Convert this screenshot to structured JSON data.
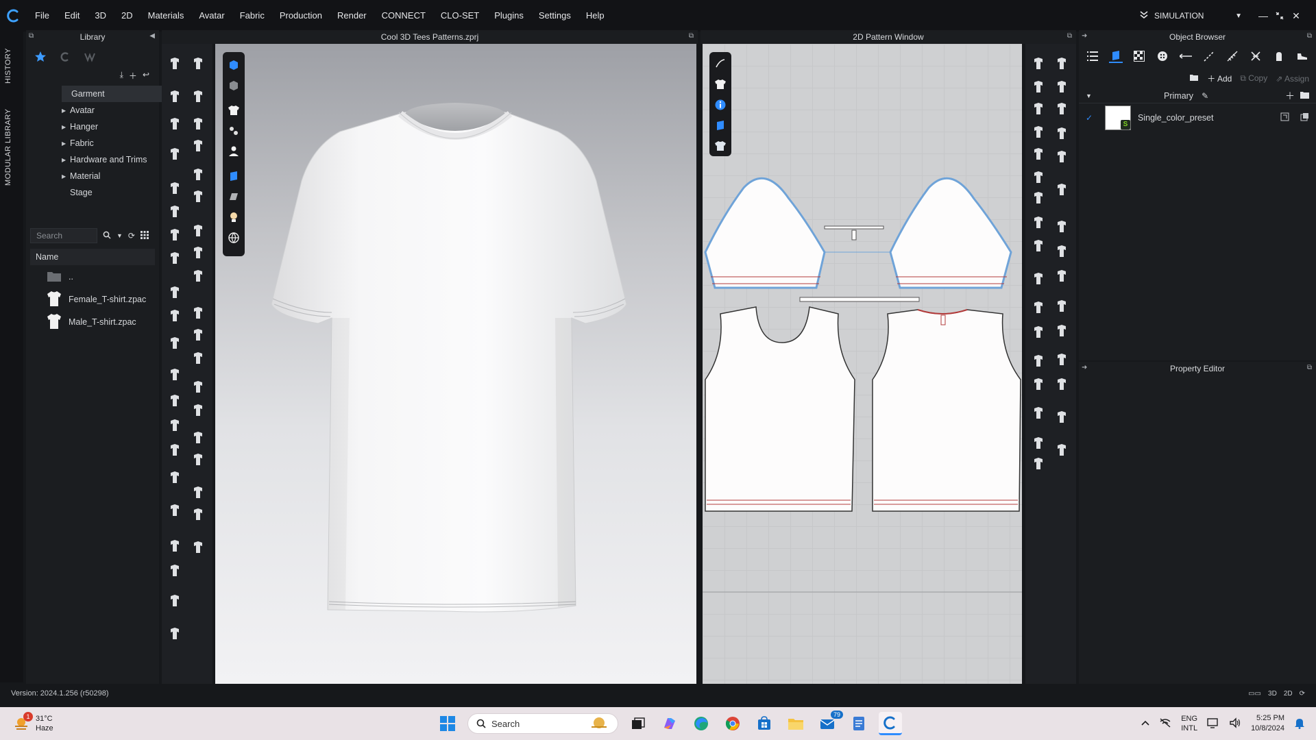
{
  "app": {
    "menu": [
      "File",
      "Edit",
      "3D",
      "2D",
      "Materials",
      "Avatar",
      "Fabric",
      "Production",
      "Render",
      "CONNECT",
      "CLO-SET",
      "Plugins",
      "Settings",
      "Help"
    ],
    "mode_label": "SIMULATION",
    "version": "Version: 2024.1.256 (r50298)"
  },
  "side_tabs": [
    "HISTORY",
    "MODULAR LIBRARY"
  ],
  "library": {
    "title": "Library",
    "tree": [
      {
        "label": "Garment",
        "expandable": false,
        "selected": true
      },
      {
        "label": "Avatar",
        "expandable": true
      },
      {
        "label": "Hanger",
        "expandable": true
      },
      {
        "label": "Fabric",
        "expandable": true
      },
      {
        "label": "Hardware and Trims",
        "expandable": true
      },
      {
        "label": "Material",
        "expandable": true
      },
      {
        "label": "Stage",
        "expandable": false
      }
    ],
    "search_placeholder": "Search",
    "column_header": "Name",
    "files": [
      {
        "label": "..",
        "icon": "folder-icon"
      },
      {
        "label": "Female_T-shirt.zpac",
        "icon": "tshirt-icon"
      },
      {
        "label": "Male_T-shirt.zpac",
        "icon": "tshirt-icon"
      }
    ]
  },
  "viewport3d": {
    "title": "Cool 3D Tees Patterns.zprj"
  },
  "pattern2d": {
    "title": "2D Pattern Window"
  },
  "object_browser": {
    "title": "Object Browser",
    "add_label": "Add",
    "copy_label": "Copy",
    "assign_label": "Assign",
    "group_label": "Primary",
    "preset_name": "Single_color_preset"
  },
  "property_editor": {
    "title": "Property Editor"
  },
  "taskbar": {
    "weather_temp": "31°C",
    "weather_desc": "Haze",
    "weather_badge": "1",
    "search_placeholder": "Search",
    "mail_badge": "79",
    "lang_1": "ENG",
    "lang_2": "INTL",
    "time": "5:25 PM",
    "date": "10/8/2024"
  },
  "colors": {
    "accent_blue": "#1e8bff",
    "stitch_red": "#b23a3a",
    "seam_blue": "#6fa3d8"
  }
}
